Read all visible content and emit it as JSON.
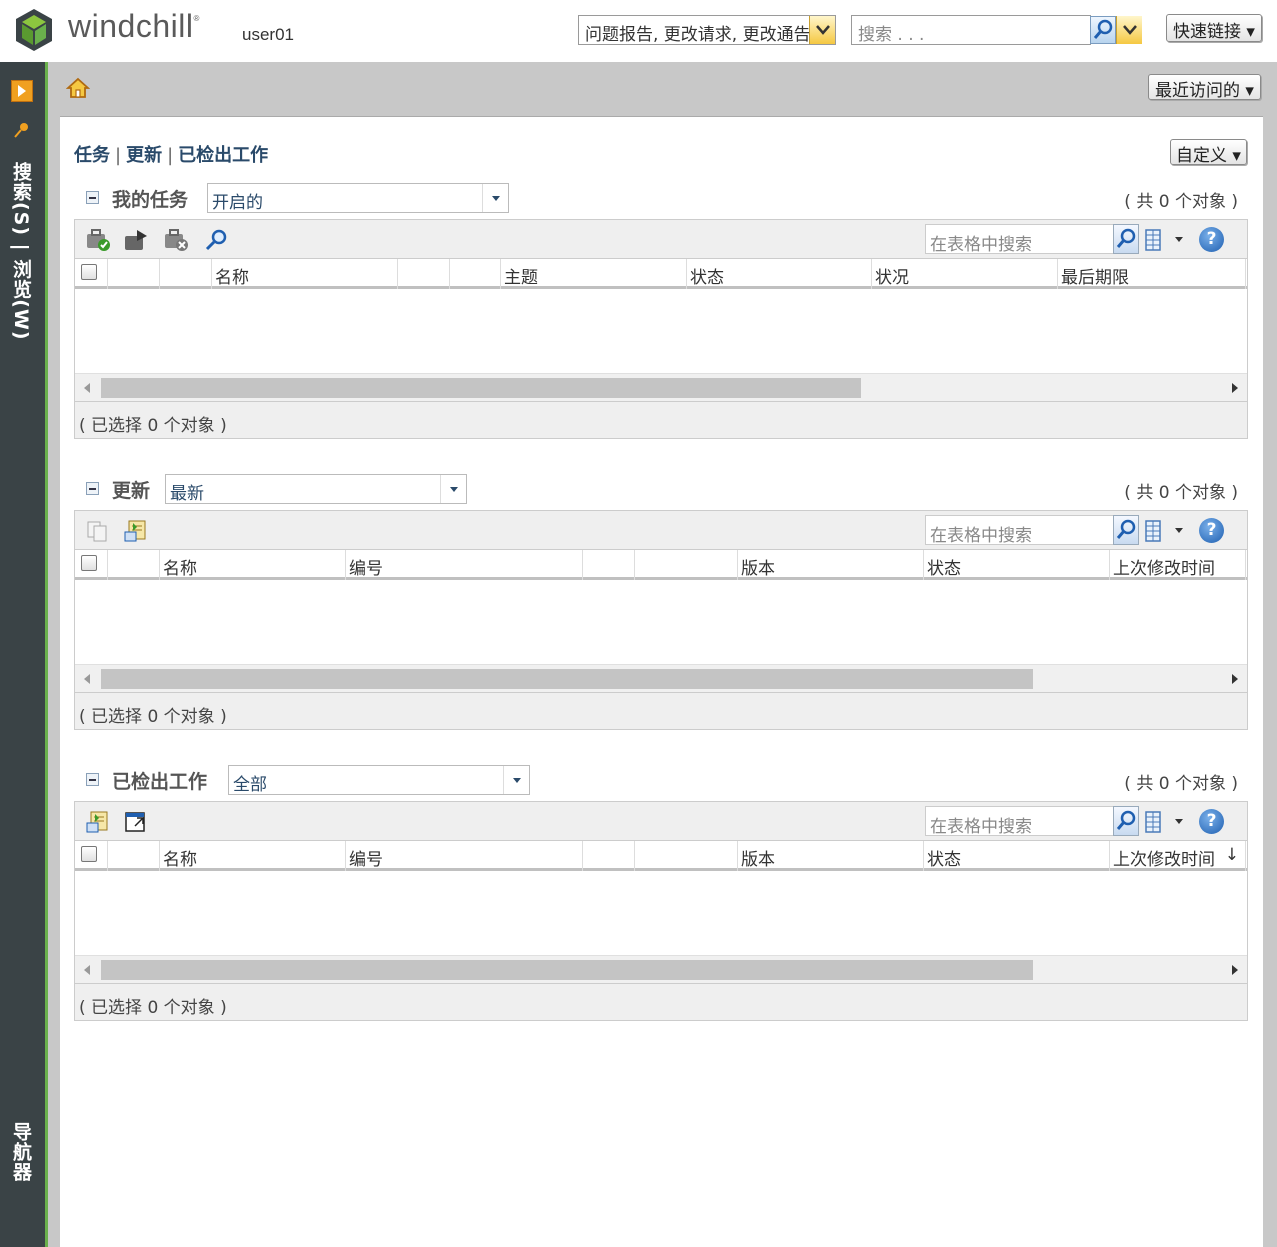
{
  "header": {
    "brand": "windchill",
    "brand_mark": "®",
    "username": "user01",
    "type_select": "问题报告, 更改请求, 更改通告",
    "search_placeholder": "搜索 . . .",
    "quick_links": "快速链接"
  },
  "leftnav": {
    "search_browse": "搜索(S) | 浏览(W)",
    "navigator": "导航器"
  },
  "topband": {
    "recent": "最近访问的"
  },
  "page": {
    "tabs": [
      "任务",
      "更新",
      "已检出工作"
    ],
    "customize": "自定义"
  },
  "sections": [
    {
      "title": "我的任务",
      "filter": "开启的",
      "count": "( 共 0 个对象 )",
      "search_placeholder": "在表格中搜索",
      "columns": [
        "",
        "",
        "名称",
        "",
        "",
        "主题",
        "状态",
        "状况",
        "最后期限"
      ],
      "selected": "( 已选择 0 个对象 )"
    },
    {
      "title": "更新",
      "filter": "最新",
      "count": "( 共 0 个对象 )",
      "search_placeholder": "在表格中搜索",
      "columns": [
        "",
        "名称",
        "编号",
        "",
        "",
        "版本",
        "状态",
        "上次修改时间"
      ],
      "selected": "( 已选择 0 个对象 )"
    },
    {
      "title": "已检出工作",
      "filter": "全部",
      "count": "( 共 0 个对象 )",
      "search_placeholder": "在表格中搜索",
      "columns": [
        "",
        "名称",
        "编号",
        "",
        "",
        "版本",
        "状态",
        "上次修改时间"
      ],
      "sort_indicator": "↓",
      "selected": "( 已选择 0 个对象 )"
    }
  ],
  "icons": {
    "help": "?"
  },
  "colors": {
    "nav_bg": "#3a4346",
    "nav_accent": "#6ab04c",
    "band_gray": "#c8c8c8",
    "link_blue": "#2a4a6a"
  }
}
